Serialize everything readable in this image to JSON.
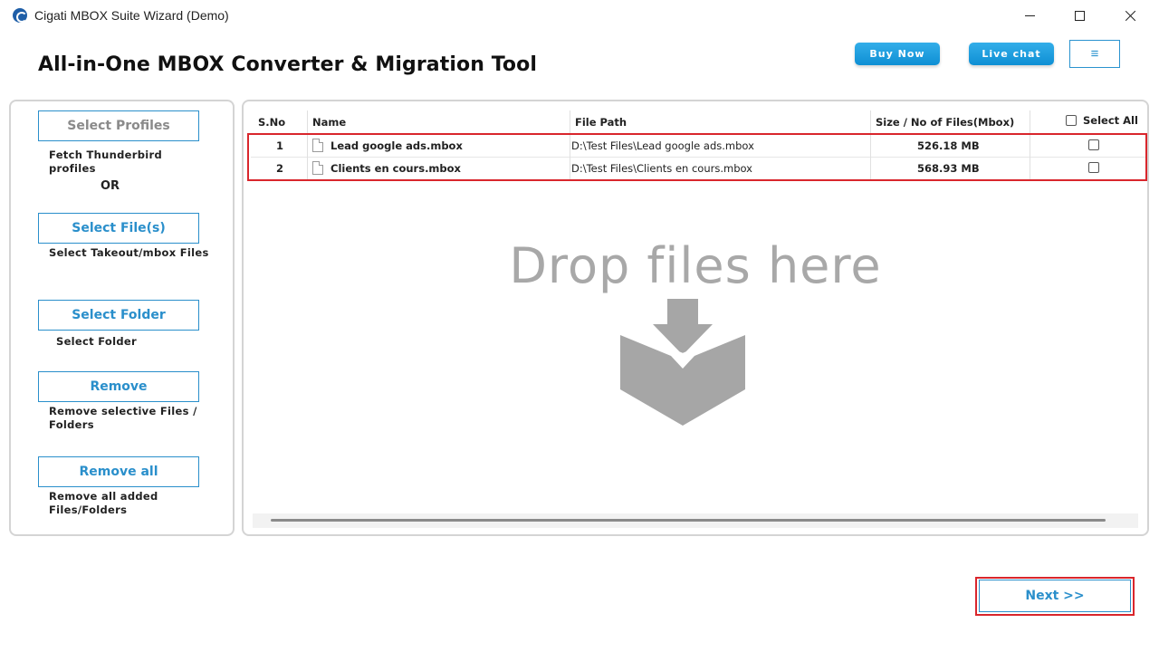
{
  "window": {
    "title": "Cigati MBOX Suite Wizard (Demo)",
    "icon": "cigati-logo-icon",
    "controls": [
      "minimize",
      "maximize",
      "close"
    ]
  },
  "header": {
    "heading": "All-in-One MBOX Converter & Migration Tool",
    "buy_now": "Buy Now",
    "live_chat": "Live chat",
    "menu_icon": "≡"
  },
  "sidebar": {
    "select_profiles": {
      "label": "Select Profiles",
      "desc": "Fetch Thunderbird profiles"
    },
    "or_text": "OR",
    "select_files": {
      "label": "Select File(s)",
      "desc": "Select Takeout/mbox Files"
    },
    "select_folder": {
      "label": "Select Folder",
      "desc": "Select Folder"
    },
    "remove": {
      "label": "Remove",
      "desc": "Remove selective Files / Folders"
    },
    "remove_all": {
      "label": "Remove all",
      "desc": "Remove all added Files/Folders"
    }
  },
  "table": {
    "columns": {
      "sno": "S.No",
      "name": "Name",
      "path": "File Path",
      "size": "Size / No of Files(Mbox)",
      "select_all": "Select All"
    },
    "rows": [
      {
        "sno": "1",
        "name": "Lead google ads.mbox",
        "path": "D:\\Test Files\\Lead google ads.mbox",
        "size": "526.18 MB",
        "checked": false
      },
      {
        "sno": "2",
        "name": "Clients en cours.mbox",
        "path": "D:\\Test Files\\Clients en cours.mbox",
        "size": "568.93 MB",
        "checked": false
      }
    ]
  },
  "drop_zone": {
    "text": "Drop files here",
    "icon": "download-box-icon"
  },
  "footer": {
    "next": "Next >>"
  },
  "colors": {
    "accent": "#2a8fcb",
    "pill_blue": "#1a9ad9",
    "highlight_red": "#d9262c",
    "drop_gray": "#a8a8a8"
  }
}
